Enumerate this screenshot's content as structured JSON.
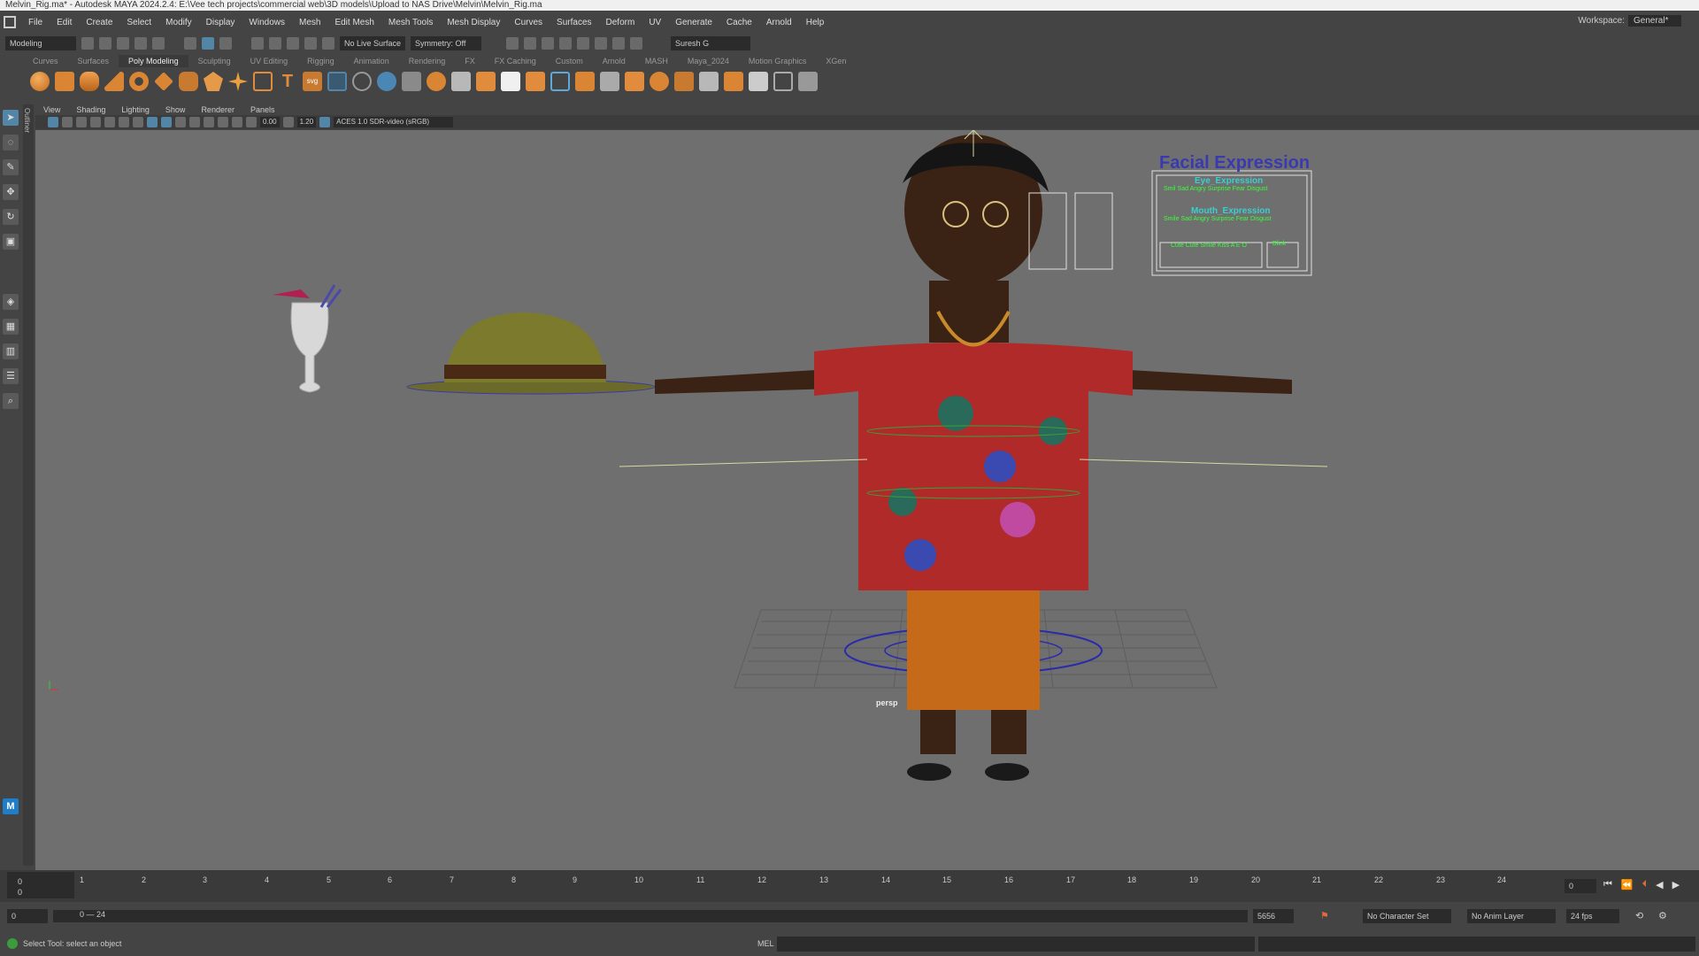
{
  "window": {
    "title": "Melvin_Rig.ma* - Autodesk MAYA 2024.2.4: E:\\Vee tech projects\\commercial web\\3D models\\Upload to NAS Drive\\Melvin\\Melvin_Rig.ma"
  },
  "menu": [
    "File",
    "Edit",
    "Create",
    "Select",
    "Modify",
    "Display",
    "Windows",
    "Mesh",
    "Edit Mesh",
    "Mesh Tools",
    "Mesh Display",
    "Curves",
    "Surfaces",
    "Deform",
    "UV",
    "Generate",
    "Cache",
    "Arnold",
    "Help"
  ],
  "workspace": {
    "label": "Workspace:",
    "value": "General*"
  },
  "statusline": {
    "mode": "Modeling",
    "live_surface": "No Live Surface",
    "symmetry": "Symmetry: Off",
    "user": "Suresh G"
  },
  "shelf_tabs": [
    "Curves",
    "Surfaces",
    "Poly Modeling",
    "Sculpting",
    "UV Editing",
    "Rigging",
    "Animation",
    "Rendering",
    "FX",
    "FX Caching",
    "Custom",
    "Arnold",
    "MASH",
    "Maya_2024",
    "Motion Graphics",
    "XGen"
  ],
  "shelf_active": "Poly Modeling",
  "panel_menu": [
    "View",
    "Shading",
    "Lighting",
    "Show",
    "Renderer",
    "Panels"
  ],
  "panel_toolbar": {
    "exposure": "0.00",
    "gamma": "1.20",
    "colorspace": "ACES 1.0 SDR-video (sRGB)"
  },
  "outliner_label": "Outliner",
  "viewport": {
    "camera": "persp",
    "facial": {
      "title": "Facial Expression",
      "eye": "Eye_Expression",
      "mouth": "Mouth_Expression",
      "eye_labels": "Smil Sad Angry Surprise Fear Disgust",
      "mouth_labels": "Smile Sad Angry Surprise Fear Disgust",
      "viseme_labels": "Cute Cute Smile Kiss A E O",
      "blink_label": "Blink"
    }
  },
  "timeline": {
    "ticks": [
      "1",
      "2",
      "3",
      "4",
      "5",
      "6",
      "7",
      "8",
      "9",
      "10",
      "11",
      "12",
      "13",
      "14",
      "15",
      "16",
      "17",
      "18",
      "19",
      "20",
      "21",
      "22",
      "23",
      "24"
    ],
    "left_top": "0",
    "left_bottom": "0",
    "current": "0"
  },
  "range": {
    "start": "0",
    "range": "0 — 24",
    "end": "5656",
    "char_set": "No Character Set",
    "anim_layer": "No Anim Layer",
    "fps": "24 fps"
  },
  "cmd": {
    "help": "Select Tool: select an object",
    "lang": "MEL"
  },
  "colors": {
    "bg": "#444444",
    "viewport": "#6f6f6f",
    "accent": "#5285a6",
    "orange_icon": "#e08c3c"
  }
}
